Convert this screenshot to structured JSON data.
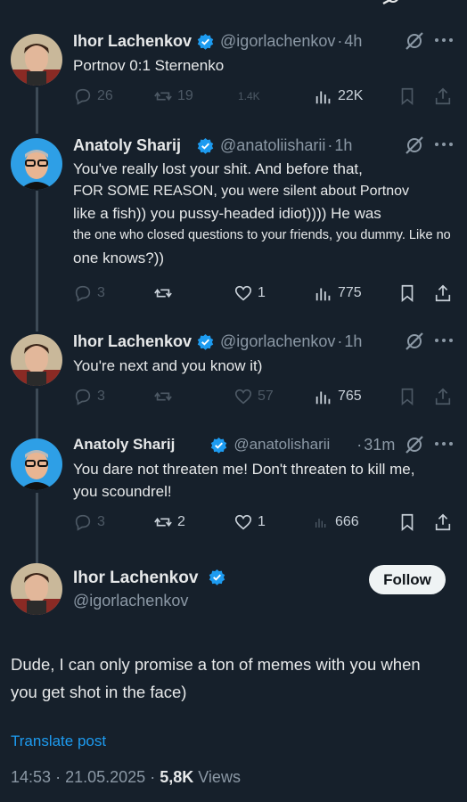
{
  "colors": {
    "background": "#16202b",
    "verified_badge": "#1d9bf0",
    "link": "#1d9bf0",
    "secondary_text": "#8b98a5",
    "thread_line": "#3d4a56"
  },
  "thread": [
    {
      "name": "Ihor Lachenkov",
      "handle": "@igorlachenkov",
      "sep": "·",
      "time": "4h",
      "lines": [
        "Portnov 0:1 Sternenko"
      ],
      "stats": {
        "replies": "26",
        "reposts": "19",
        "likes": "1.4K",
        "views": "22K"
      }
    },
    {
      "name": "Anatoly Sharij",
      "handle": "@anatoliisharii",
      "sep": "·",
      "time": "1h",
      "lines": [
        "You've really lost your shit. And before that,",
        "FOR SOME REASON, you were silent about Portnov",
        "like a fish)) you pussy-headed idiot)))) He was",
        "the one who closed questions to your friends, you dummy. Like no",
        "one knows?))"
      ],
      "stats": {
        "replies": "3",
        "reposts": "",
        "likes": "1",
        "views": "775"
      }
    },
    {
      "name": "Ihor Lachenkov",
      "handle": "@igorlachenkov",
      "sep": "·",
      "time": "1h",
      "lines": [
        "You're next and you know it)"
      ],
      "stats": {
        "replies": "3",
        "reposts": "",
        "likes": "57",
        "views": "765"
      }
    },
    {
      "name": "Anatoly Sharij",
      "handle": "@anatolisharii",
      "sep": "·",
      "time": "31m",
      "lines": [
        "You dare not threaten me! Don't threaten to kill me,",
        "you scoundrel!"
      ],
      "stats": {
        "replies": "3",
        "reposts": "2",
        "likes": "1",
        "views": "666"
      }
    }
  ],
  "main_post": {
    "name": "Ihor Lachenkov",
    "handle": "@igorlachenkov",
    "follow_label": "Follow",
    "lines": [
      "Dude, I can only promise a ton of memes with you when",
      "you get shot in the face)"
    ],
    "translate_label": "Translate post",
    "time": "14:53",
    "date": "21.05.2025",
    "sep": "·",
    "views_count": "5,8K",
    "views_label": "Views"
  },
  "icons": [
    "reply-icon",
    "repost-icon",
    "like-icon",
    "views-icon",
    "bookmark-icon",
    "share-icon",
    "grok-icon",
    "more-icon",
    "verified-badge-icon"
  ]
}
